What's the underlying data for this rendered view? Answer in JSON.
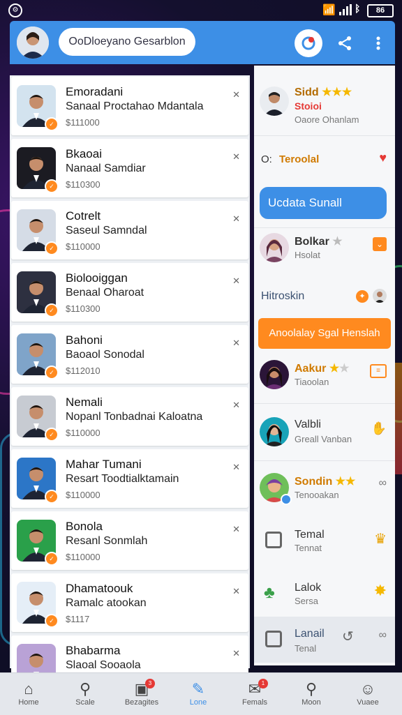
{
  "status": {
    "battery": "86"
  },
  "header": {
    "search_text": "OoDloeyano Gesarblon"
  },
  "list_items": [
    {
      "t1": "Emoradani",
      "t2": "Sanaal Proctahao Mdantala",
      "t3": "$111000",
      "icon": "close-icon",
      "bg": "#d3e3ef"
    },
    {
      "t1": "Bkaoai",
      "t2": "Nanaal Samdiar",
      "t3": "$110300",
      "icon": "close-icon",
      "bg": "#1b1b22"
    },
    {
      "t1": "Cotrelt",
      "t2": "Saseul Samndal",
      "t3": "$110000",
      "icon": "close-icon",
      "bg": "#d5dce6"
    },
    {
      "t1": "Biolooiggan",
      "t2": "Benaal Oharoat",
      "t3": "$110300",
      "icon": "close-icon",
      "bg": "#2d3040"
    },
    {
      "t1": "Bahoni",
      "t2": "Baoaol Sonodal",
      "t3": "$112010",
      "icon": "close-icon",
      "bg": "#7fa4c9"
    },
    {
      "t1": "Nemali",
      "t2": "Nopanl Tonbadnai Kaloatna",
      "t3": "$110000",
      "icon": "close-icon",
      "bg": "#c7cbd2"
    },
    {
      "t1": "Mahar Tumani",
      "t2": "Resart Toodtialktamain",
      "t3": "$110000",
      "icon": "close-icon",
      "bg": "#2c76c7"
    },
    {
      "t1": "Bonola",
      "t2": "Resanl Sonmlah",
      "t3": "$110000",
      "icon": "close-icon",
      "bg": "#2aa04a"
    },
    {
      "t1": "Dhamatoouk",
      "t2": "Ramalc atookan",
      "t3": "$1117",
      "icon": "close-icon",
      "bg": "#e5eef7"
    },
    {
      "t1": "Bhabarma",
      "t2": "Slaoal Sooaola",
      "t3": "",
      "icon": "close-icon",
      "bg": "#b9a2d6"
    }
  ],
  "panel": {
    "profile": {
      "name": "Sidd",
      "sub1": "Stoioi",
      "sub2": "Oaore Ohanlam"
    },
    "row_teroolal": {
      "prefix": "O:",
      "label": "Teroolal"
    },
    "cta_blue": "Ucdata Sunall",
    "row_bolkar": {
      "name": "Bolkar",
      "sub": "Hsolat"
    },
    "row_hitroskin": {
      "label": "Hitroskin"
    },
    "cta_orange": "Anoolalay Sgal Henslah",
    "row_aakur": {
      "name": "Aakur",
      "sub": "Tiaoolan"
    },
    "row_valbli": {
      "name": "Valbli",
      "sub": "Greall Vanban"
    },
    "row_sondin": {
      "name": "Sondin",
      "sub": "Tenooakan"
    },
    "row_temal": {
      "name": "Temal",
      "sub": "Tennat"
    },
    "row_lalok": {
      "name": "Lalok",
      "sub": "Sersa"
    },
    "row_lanail": {
      "name": "Lanail",
      "sub": "Tenal"
    }
  },
  "bottom_nav": [
    {
      "label": "Home",
      "active": false
    },
    {
      "label": "Scale",
      "active": false
    },
    {
      "label": "Bezagites",
      "active": false,
      "badge": "3"
    },
    {
      "label": "Lone",
      "active": true
    },
    {
      "label": "Femals",
      "active": false,
      "badge": "1"
    },
    {
      "label": "Moon",
      "active": false
    },
    {
      "label": "Vuaee",
      "active": false
    }
  ],
  "colors": {
    "accent": "#3d8fe6",
    "orange": "#ff8a1f",
    "star": "#f5b800"
  }
}
